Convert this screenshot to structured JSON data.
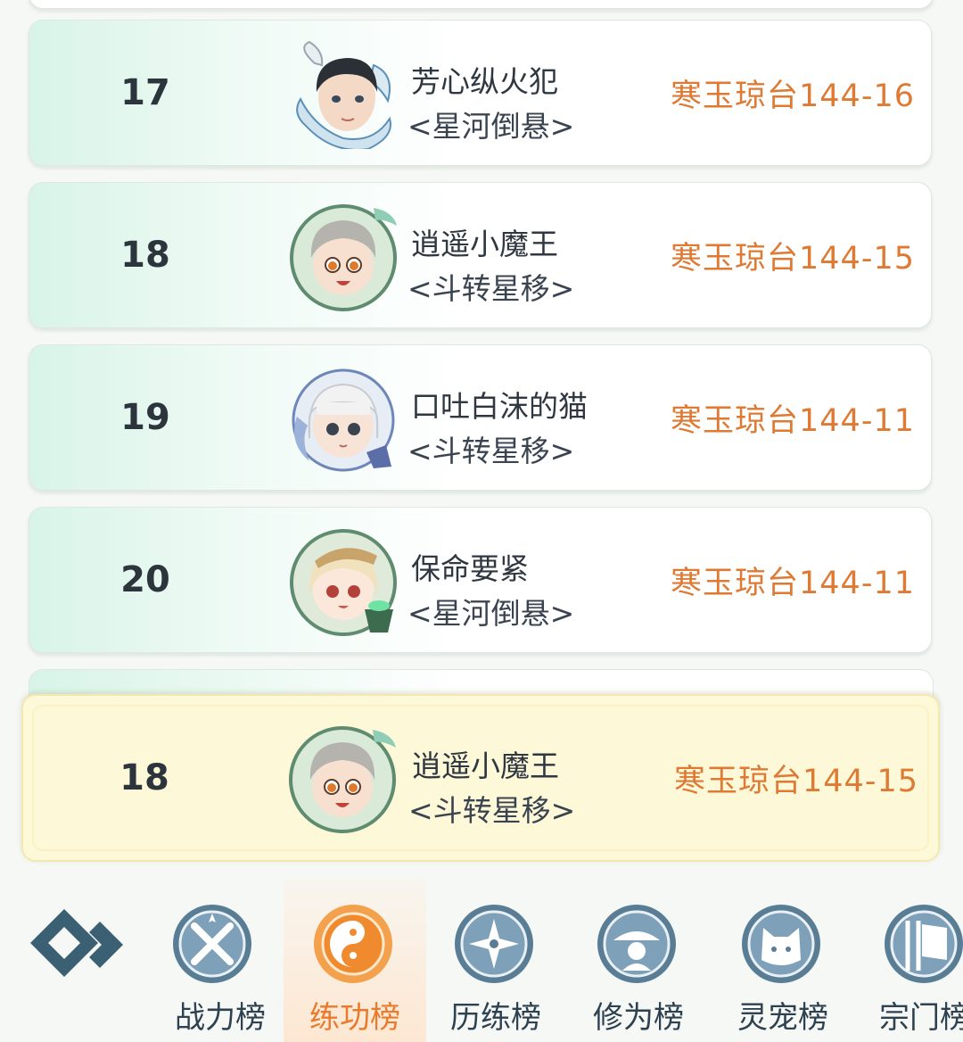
{
  "leaderboard": {
    "rows": [
      {
        "rank": "17",
        "name": "芳心纵火犯",
        "sect": "星河倒悬",
        "server": "寒玉琼台144-16",
        "avatar_icon": "dragon-hero-avatar-icon"
      },
      {
        "rank": "18",
        "name": "逍遥小魔王",
        "sect": "斗转星移",
        "server": "寒玉琼台144-15",
        "avatar_icon": "gray-hair-boy-avatar-icon"
      },
      {
        "rank": "19",
        "name": "口吐白沫的猫",
        "sect": "斗转星移",
        "server": "寒玉琼台144-11",
        "avatar_icon": "white-hair-girl-avatar-icon"
      },
      {
        "rank": "20",
        "name": "保命要紧",
        "sect": "星河倒悬",
        "server": "寒玉琼台144-11",
        "avatar_icon": "blonde-girl-avatar-icon"
      }
    ],
    "my_rank": {
      "rank": "18",
      "name": "逍遥小魔王",
      "sect": "斗转星移",
      "server": "寒玉琼台144-15"
    }
  },
  "bottom_nav": {
    "items": [
      {
        "label": "",
        "icon": "menu-diamond-icon"
      },
      {
        "label": "战力榜",
        "icon": "crossed-swords-icon"
      },
      {
        "label": "练功榜",
        "icon": "yin-yang-icon",
        "active": true
      },
      {
        "label": "历练榜",
        "icon": "shuriken-icon"
      },
      {
        "label": "修为榜",
        "icon": "hat-figure-icon"
      },
      {
        "label": "灵宠榜",
        "icon": "cat-icon"
      },
      {
        "label": "宗门榜",
        "icon": "banner-icon"
      }
    ]
  },
  "colors": {
    "server_text": "#de7a33",
    "active_tab": "#ea7a2c",
    "tab_text": "#2d4150"
  }
}
